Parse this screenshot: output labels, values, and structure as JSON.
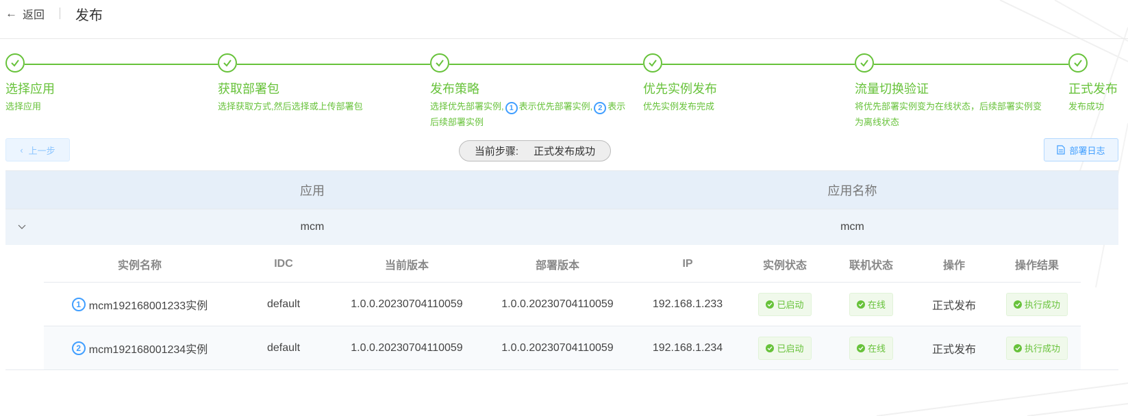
{
  "header": {
    "back_label": "返回",
    "title": "发布"
  },
  "steps": [
    {
      "title": "选择应用",
      "desc": "选择应用"
    },
    {
      "title": "获取部署包",
      "desc": "选择获取方式,然后选择或上传部署包"
    },
    {
      "title": "发布策略",
      "desc_a": "选择优先部署实例,",
      "desc_b": "表示优先部署实例,",
      "desc_c": "表示后续部署实例",
      "n1": "1",
      "n2": "2"
    },
    {
      "title": "优先实例发布",
      "desc": "优先实例发布完成"
    },
    {
      "title": "流量切换验证",
      "desc": "将优先部署实例变为在线状态，后续部署实例变为离线状态"
    },
    {
      "title": "正式发布",
      "desc": "发布成功"
    }
  ],
  "toolbar": {
    "prev_label": "上一步",
    "current_step_label": "当前步骤:",
    "current_step_value": "正式发布成功",
    "log_label": "部署日志"
  },
  "outer_table": {
    "headers": [
      "应用",
      "应用名称"
    ],
    "row": {
      "app": "mcm",
      "app_name": "mcm"
    }
  },
  "inner_table": {
    "headers": [
      "实例名称",
      "IDC",
      "当前版本",
      "部署版本",
      "IP",
      "实例状态",
      "联机状态",
      "操作",
      "操作结果"
    ],
    "rows": [
      {
        "num": "1",
        "name": "mcm192168001233实例",
        "idc": "default",
        "cur_ver": "1.0.0.20230704110059",
        "dep_ver": "1.0.0.20230704110059",
        "ip": "192.168.1.233",
        "inst_status": "已启动",
        "online": "在线",
        "op": "正式发布",
        "result": "执行成功"
      },
      {
        "num": "2",
        "name": "mcm192168001234实例",
        "idc": "default",
        "cur_ver": "1.0.0.20230704110059",
        "dep_ver": "1.0.0.20230704110059",
        "ip": "192.168.1.234",
        "inst_status": "已启动",
        "online": "在线",
        "op": "正式发布",
        "result": "执行成功"
      }
    ]
  },
  "colors": {
    "success": "#67c23a",
    "primary": "#409eff",
    "header_bg": "#e6eff9"
  }
}
